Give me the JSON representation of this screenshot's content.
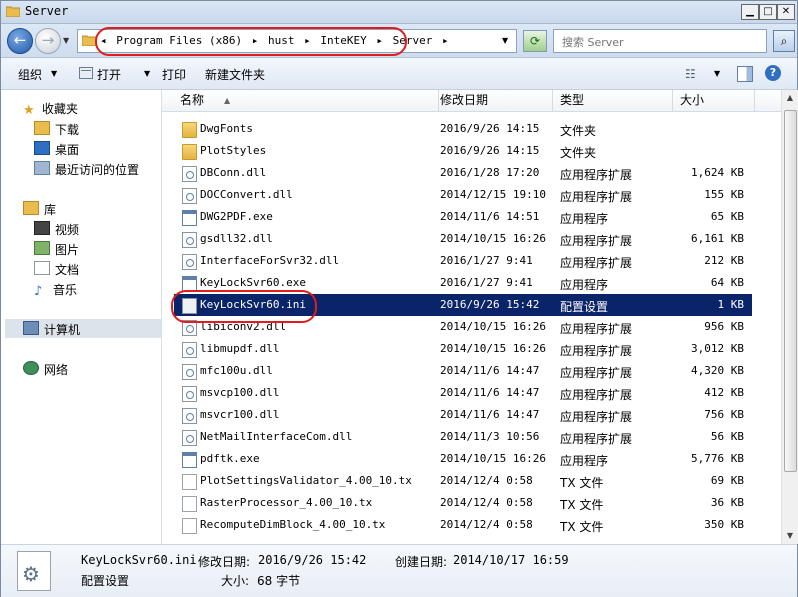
{
  "window": {
    "title": "Server"
  },
  "address": {
    "breadcrumb": [
      "Program Files (x86)",
      "hust",
      "InteKEY",
      "Server"
    ],
    "separator": "▸"
  },
  "search": {
    "placeholder": "搜索 Server"
  },
  "toolbar": {
    "organize": "组织",
    "open": "打开",
    "print": "打印",
    "new_folder": "新建文件夹",
    "help": "?"
  },
  "nav": {
    "favorites": "收藏夹",
    "downloads": "下载",
    "desktop": "桌面",
    "recent": "最近访问的位置",
    "libraries": "库",
    "videos": "视频",
    "pictures": "图片",
    "documents": "文档",
    "music": "音乐",
    "computer": "计算机",
    "network": "网络"
  },
  "columns": {
    "name": "名称",
    "date": "修改日期",
    "type": "类型",
    "size": "大小"
  },
  "files": [
    {
      "name": "DwgFonts",
      "date": "2016/9/26 14:15",
      "type": "文件夹",
      "size": "",
      "icon": "folder-icon"
    },
    {
      "name": "PlotStyles",
      "date": "2016/9/26 14:15",
      "type": "文件夹",
      "size": "",
      "icon": "folder-icon"
    },
    {
      "name": "DBConn.dll",
      "date": "2016/1/28 17:20",
      "type": "应用程序扩展",
      "size": "1,624 KB",
      "icon": "dll-icon"
    },
    {
      "name": "DOCConvert.dll",
      "date": "2014/12/15 19:10",
      "type": "应用程序扩展",
      "size": "155 KB",
      "icon": "dll-icon"
    },
    {
      "name": "DWG2PDF.exe",
      "date": "2014/11/6 14:51",
      "type": "应用程序",
      "size": "65 KB",
      "icon": "exe-icon"
    },
    {
      "name": "gsdll32.dll",
      "date": "2014/10/15 16:26",
      "type": "应用程序扩展",
      "size": "6,161 KB",
      "icon": "dll-icon"
    },
    {
      "name": "InterfaceForSvr32.dll",
      "date": "2016/1/27 9:41",
      "type": "应用程序扩展",
      "size": "212 KB",
      "icon": "dll-icon"
    },
    {
      "name": "KeyLockSvr60.exe",
      "date": "2016/1/27 9:41",
      "type": "应用程序",
      "size": "64 KB",
      "icon": "exe-icon"
    },
    {
      "name": "KeyLockSvr60.ini",
      "date": "2016/9/26 15:42",
      "type": "配置设置",
      "size": "1 KB",
      "icon": "ini-icon",
      "selected": true
    },
    {
      "name": "libiconv2.dll",
      "date": "2014/10/15 16:26",
      "type": "应用程序扩展",
      "size": "956 KB",
      "icon": "dll-icon"
    },
    {
      "name": "libmupdf.dll",
      "date": "2014/10/15 16:26",
      "type": "应用程序扩展",
      "size": "3,012 KB",
      "icon": "dll-icon"
    },
    {
      "name": "mfc100u.dll",
      "date": "2014/11/6 14:47",
      "type": "应用程序扩展",
      "size": "4,320 KB",
      "icon": "dll-icon"
    },
    {
      "name": "msvcp100.dll",
      "date": "2014/11/6 14:47",
      "type": "应用程序扩展",
      "size": "412 KB",
      "icon": "dll-icon"
    },
    {
      "name": "msvcr100.dll",
      "date": "2014/11/6 14:47",
      "type": "应用程序扩展",
      "size": "756 KB",
      "icon": "dll-icon"
    },
    {
      "name": "NetMailInterfaceCom.dll",
      "date": "2014/11/3 10:56",
      "type": "应用程序扩展",
      "size": "56 KB",
      "icon": "dll-icon"
    },
    {
      "name": "pdftk.exe",
      "date": "2014/10/15 16:26",
      "type": "应用程序",
      "size": "5,776 KB",
      "icon": "exe-icon"
    },
    {
      "name": "PlotSettingsValidator_4.00_10.tx",
      "date": "2014/12/4 0:58",
      "type": "TX 文件",
      "size": "69 KB",
      "icon": "tx-icon"
    },
    {
      "name": "RasterProcessor_4.00_10.tx",
      "date": "2014/12/4 0:58",
      "type": "TX 文件",
      "size": "36 KB",
      "icon": "tx-icon"
    },
    {
      "name": "RecomputeDimBlock_4.00_10.tx",
      "date": "2014/12/4 0:58",
      "type": "TX 文件",
      "size": "350 KB",
      "icon": "tx-icon"
    }
  ],
  "details": {
    "filename": "KeyLockSvr60.ini",
    "modified_label": "修改日期:",
    "modified_value": "2016/9/26 15:42",
    "created_label": "创建日期:",
    "created_value": "2014/10/17 16:59",
    "type": "配置设置",
    "size_label": "大小:",
    "size_value": "68 字节"
  },
  "colors": {
    "selection": "#0a246a",
    "highlight_circle": "#e01c1c"
  }
}
